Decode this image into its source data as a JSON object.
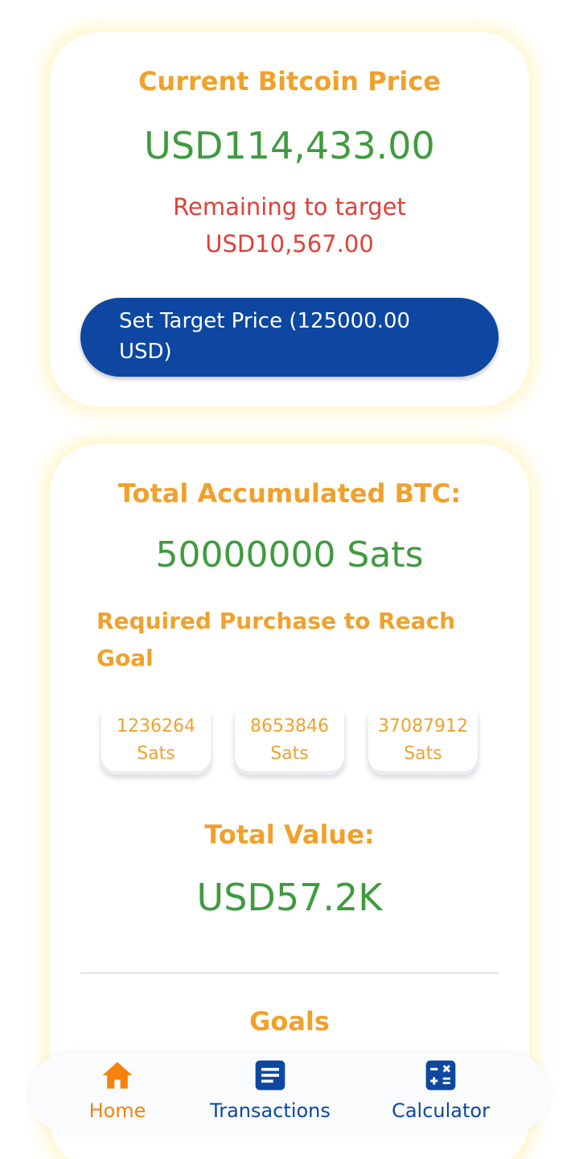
{
  "price_card": {
    "title": "Current Bitcoin Price",
    "price": "USD114,433.00",
    "remaining_label": "Remaining to target",
    "remaining_value": "USD10,567.00",
    "target_button": "Set Target Price (125000.00 USD)"
  },
  "btc_card": {
    "accumulated_title": "Total Accumulated BTC:",
    "accumulated_value": "50000000 Sats",
    "required_title": "Required Purchase to Reach Goal",
    "required_options": [
      {
        "amount": "1236264",
        "unit": "Sats"
      },
      {
        "amount": "8653846",
        "unit": "Sats"
      },
      {
        "amount": "37087912",
        "unit": "Sats"
      }
    ],
    "total_value_title": "Total Value:",
    "total_value": "USD57.2K",
    "goals_title": "Goals"
  },
  "bottom_nav": {
    "items": [
      {
        "label": "Home",
        "icon": "home-icon",
        "active": true
      },
      {
        "label": "Transactions",
        "icon": "document-icon",
        "active": false
      },
      {
        "label": "Calculator",
        "icon": "calculator-icon",
        "active": false
      }
    ]
  },
  "colors": {
    "accent_orange": "#f0a12b",
    "value_green": "#3f9b3f",
    "alert_red": "#e0403a",
    "button_blue": "#0d47a1",
    "nav_active": "#f5820d",
    "nav_inactive": "#0d47a1"
  }
}
